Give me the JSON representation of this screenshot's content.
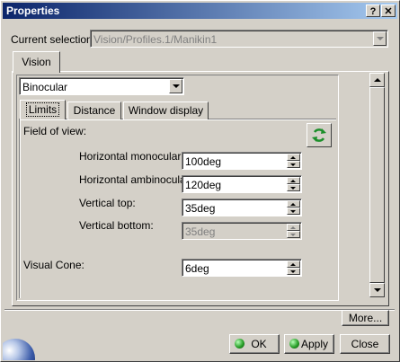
{
  "window": {
    "title": "Properties",
    "help_label": "?",
    "close_label": "✕"
  },
  "selection": {
    "label": "Current selection :",
    "value": "Vision/Profiles.1/Manikin1"
  },
  "main_tab": {
    "label": "Vision"
  },
  "mode_dropdown": {
    "value": "Binocular"
  },
  "sub_tabs": [
    {
      "label": "Limits"
    },
    {
      "label": "Distance"
    },
    {
      "label": "Window display"
    }
  ],
  "field_of_view": {
    "heading": "Field of view:",
    "horizontal_monocular": {
      "label": "Horizontal monocular:",
      "value": "100deg"
    },
    "horizontal_ambinocular": {
      "label": "Horizontal ambinocular:",
      "value": "120deg"
    },
    "vertical_top": {
      "label": "Vertical top:",
      "value": "35deg"
    },
    "vertical_bottom": {
      "label": "Vertical bottom:",
      "value": "35deg"
    }
  },
  "visual_cone": {
    "label": "Visual Cone:",
    "value": "6deg"
  },
  "buttons": {
    "more": "More...",
    "ok": "OK",
    "apply": "Apply",
    "close": "Close"
  },
  "icons": {
    "refresh": "refresh-icon",
    "ok_ball": "green-ball-icon",
    "apply_ball": "green-ball-icon"
  },
  "colors": {
    "titlebar_start": "#0a246a",
    "titlebar_end": "#a6caf0",
    "refresh_arrow": "#1c8f2a",
    "ok_ball": "#2aa02a"
  }
}
